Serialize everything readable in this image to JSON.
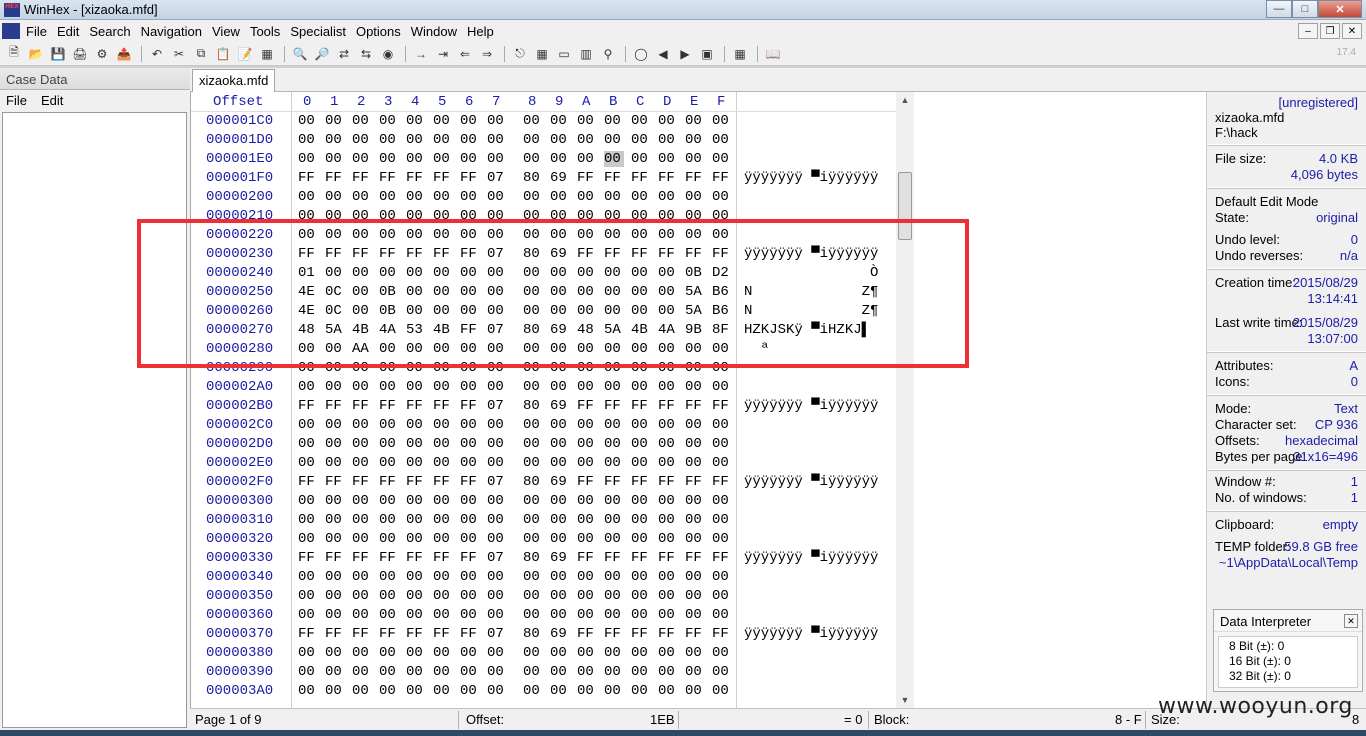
{
  "window": {
    "title": "WinHex - [xizaoka.mfd]",
    "app_icon_text": "HEX"
  },
  "menu": {
    "items": [
      "File",
      "Edit",
      "Search",
      "Navigation",
      "View",
      "Tools",
      "Specialist",
      "Options",
      "Window",
      "Help"
    ]
  },
  "toolbar": {
    "zoom_label": "17.4"
  },
  "case_pane": {
    "title": "Case Data",
    "menu": [
      "File",
      "Edit"
    ]
  },
  "tab": {
    "label": "xizaoka.mfd"
  },
  "hex": {
    "header_offset": "Offset",
    "header_cols": [
      "0",
      "1",
      "2",
      "3",
      "4",
      "5",
      "6",
      "7",
      "8",
      "9",
      "A",
      "B",
      "C",
      "D",
      "E",
      "F"
    ],
    "rows": [
      {
        "off": "000001C0",
        "bytes": [
          "00",
          "00",
          "00",
          "00",
          "00",
          "00",
          "00",
          "00",
          "00",
          "00",
          "00",
          "00",
          "00",
          "00",
          "00",
          "00"
        ],
        "txt": ""
      },
      {
        "off": "000001D0",
        "bytes": [
          "00",
          "00",
          "00",
          "00",
          "00",
          "00",
          "00",
          "00",
          "00",
          "00",
          "00",
          "00",
          "00",
          "00",
          "00",
          "00"
        ],
        "txt": ""
      },
      {
        "off": "000001E0",
        "bytes": [
          "00",
          "00",
          "00",
          "00",
          "00",
          "00",
          "00",
          "00",
          "00",
          "00",
          "00",
          "00",
          "00",
          "00",
          "00",
          "00"
        ],
        "txt": ""
      },
      {
        "off": "000001F0",
        "bytes": [
          "FF",
          "FF",
          "FF",
          "FF",
          "FF",
          "FF",
          "FF",
          "07",
          "80",
          "69",
          "FF",
          "FF",
          "FF",
          "FF",
          "FF",
          "FF"
        ],
        "txt": "ÿÿÿÿÿÿÿ ▀iÿÿÿÿÿÿ"
      },
      {
        "off": "00000200",
        "bytes": [
          "00",
          "00",
          "00",
          "00",
          "00",
          "00",
          "00",
          "00",
          "00",
          "00",
          "00",
          "00",
          "00",
          "00",
          "00",
          "00"
        ],
        "txt": ""
      },
      {
        "off": "00000210",
        "bytes": [
          "00",
          "00",
          "00",
          "00",
          "00",
          "00",
          "00",
          "00",
          "00",
          "00",
          "00",
          "00",
          "00",
          "00",
          "00",
          "00"
        ],
        "txt": ""
      },
      {
        "off": "00000220",
        "bytes": [
          "00",
          "00",
          "00",
          "00",
          "00",
          "00",
          "00",
          "00",
          "00",
          "00",
          "00",
          "00",
          "00",
          "00",
          "00",
          "00"
        ],
        "txt": ""
      },
      {
        "off": "00000230",
        "bytes": [
          "FF",
          "FF",
          "FF",
          "FF",
          "FF",
          "FF",
          "FF",
          "07",
          "80",
          "69",
          "FF",
          "FF",
          "FF",
          "FF",
          "FF",
          "FF"
        ],
        "txt": "ÿÿÿÿÿÿÿ ▀iÿÿÿÿÿÿ"
      },
      {
        "off": "00000240",
        "bytes": [
          "01",
          "00",
          "00",
          "00",
          "00",
          "00",
          "00",
          "00",
          "00",
          "00",
          "00",
          "00",
          "00",
          "00",
          "0B",
          "D2"
        ],
        "txt": "               Ò"
      },
      {
        "off": "00000250",
        "bytes": [
          "4E",
          "0C",
          "00",
          "0B",
          "00",
          "00",
          "00",
          "00",
          "00",
          "00",
          "00",
          "00",
          "00",
          "00",
          "5A",
          "B6"
        ],
        "txt": "N             Z¶"
      },
      {
        "off": "00000260",
        "bytes": [
          "4E",
          "0C",
          "00",
          "0B",
          "00",
          "00",
          "00",
          "00",
          "00",
          "00",
          "00",
          "00",
          "00",
          "00",
          "5A",
          "B6"
        ],
        "txt": "N             Z¶"
      },
      {
        "off": "00000270",
        "bytes": [
          "48",
          "5A",
          "4B",
          "4A",
          "53",
          "4B",
          "FF",
          "07",
          "80",
          "69",
          "48",
          "5A",
          "4B",
          "4A",
          "9B",
          "8F"
        ],
        "txt": "HZKJSKÿ ▀iHZKJ▌"
      },
      {
        "off": "00000280",
        "bytes": [
          "00",
          "00",
          "AA",
          "00",
          "00",
          "00",
          "00",
          "00",
          "00",
          "00",
          "00",
          "00",
          "00",
          "00",
          "00",
          "00"
        ],
        "txt": "  ª"
      },
      {
        "off": "00000290",
        "bytes": [
          "00",
          "00",
          "00",
          "00",
          "00",
          "00",
          "00",
          "00",
          "00",
          "00",
          "00",
          "00",
          "00",
          "00",
          "00",
          "00"
        ],
        "txt": ""
      },
      {
        "off": "000002A0",
        "bytes": [
          "00",
          "00",
          "00",
          "00",
          "00",
          "00",
          "00",
          "00",
          "00",
          "00",
          "00",
          "00",
          "00",
          "00",
          "00",
          "00"
        ],
        "txt": ""
      },
      {
        "off": "000002B0",
        "bytes": [
          "FF",
          "FF",
          "FF",
          "FF",
          "FF",
          "FF",
          "FF",
          "07",
          "80",
          "69",
          "FF",
          "FF",
          "FF",
          "FF",
          "FF",
          "FF"
        ],
        "txt": "ÿÿÿÿÿÿÿ ▀iÿÿÿÿÿÿ"
      },
      {
        "off": "000002C0",
        "bytes": [
          "00",
          "00",
          "00",
          "00",
          "00",
          "00",
          "00",
          "00",
          "00",
          "00",
          "00",
          "00",
          "00",
          "00",
          "00",
          "00"
        ],
        "txt": ""
      },
      {
        "off": "000002D0",
        "bytes": [
          "00",
          "00",
          "00",
          "00",
          "00",
          "00",
          "00",
          "00",
          "00",
          "00",
          "00",
          "00",
          "00",
          "00",
          "00",
          "00"
        ],
        "txt": ""
      },
      {
        "off": "000002E0",
        "bytes": [
          "00",
          "00",
          "00",
          "00",
          "00",
          "00",
          "00",
          "00",
          "00",
          "00",
          "00",
          "00",
          "00",
          "00",
          "00",
          "00"
        ],
        "txt": ""
      },
      {
        "off": "000002F0",
        "bytes": [
          "FF",
          "FF",
          "FF",
          "FF",
          "FF",
          "FF",
          "FF",
          "07",
          "80",
          "69",
          "FF",
          "FF",
          "FF",
          "FF",
          "FF",
          "FF"
        ],
        "txt": "ÿÿÿÿÿÿÿ ▀iÿÿÿÿÿÿ"
      },
      {
        "off": "00000300",
        "bytes": [
          "00",
          "00",
          "00",
          "00",
          "00",
          "00",
          "00",
          "00",
          "00",
          "00",
          "00",
          "00",
          "00",
          "00",
          "00",
          "00"
        ],
        "txt": ""
      },
      {
        "off": "00000310",
        "bytes": [
          "00",
          "00",
          "00",
          "00",
          "00",
          "00",
          "00",
          "00",
          "00",
          "00",
          "00",
          "00",
          "00",
          "00",
          "00",
          "00"
        ],
        "txt": ""
      },
      {
        "off": "00000320",
        "bytes": [
          "00",
          "00",
          "00",
          "00",
          "00",
          "00",
          "00",
          "00",
          "00",
          "00",
          "00",
          "00",
          "00",
          "00",
          "00",
          "00"
        ],
        "txt": ""
      },
      {
        "off": "00000330",
        "bytes": [
          "FF",
          "FF",
          "FF",
          "FF",
          "FF",
          "FF",
          "FF",
          "07",
          "80",
          "69",
          "FF",
          "FF",
          "FF",
          "FF",
          "FF",
          "FF"
        ],
        "txt": "ÿÿÿÿÿÿÿ ▀iÿÿÿÿÿÿ"
      },
      {
        "off": "00000340",
        "bytes": [
          "00",
          "00",
          "00",
          "00",
          "00",
          "00",
          "00",
          "00",
          "00",
          "00",
          "00",
          "00",
          "00",
          "00",
          "00",
          "00"
        ],
        "txt": ""
      },
      {
        "off": "00000350",
        "bytes": [
          "00",
          "00",
          "00",
          "00",
          "00",
          "00",
          "00",
          "00",
          "00",
          "00",
          "00",
          "00",
          "00",
          "00",
          "00",
          "00"
        ],
        "txt": ""
      },
      {
        "off": "00000360",
        "bytes": [
          "00",
          "00",
          "00",
          "00",
          "00",
          "00",
          "00",
          "00",
          "00",
          "00",
          "00",
          "00",
          "00",
          "00",
          "00",
          "00"
        ],
        "txt": ""
      },
      {
        "off": "00000370",
        "bytes": [
          "FF",
          "FF",
          "FF",
          "FF",
          "FF",
          "FF",
          "FF",
          "07",
          "80",
          "69",
          "FF",
          "FF",
          "FF",
          "FF",
          "FF",
          "FF"
        ],
        "txt": "ÿÿÿÿÿÿÿ ▀iÿÿÿÿÿÿ"
      },
      {
        "off": "00000380",
        "bytes": [
          "00",
          "00",
          "00",
          "00",
          "00",
          "00",
          "00",
          "00",
          "00",
          "00",
          "00",
          "00",
          "00",
          "00",
          "00",
          "00"
        ],
        "txt": ""
      },
      {
        "off": "00000390",
        "bytes": [
          "00",
          "00",
          "00",
          "00",
          "00",
          "00",
          "00",
          "00",
          "00",
          "00",
          "00",
          "00",
          "00",
          "00",
          "00",
          "00"
        ],
        "txt": ""
      },
      {
        "off": "000003A0",
        "bytes": [
          "00",
          "00",
          "00",
          "00",
          "00",
          "00",
          "00",
          "00",
          "00",
          "00",
          "00",
          "00",
          "00",
          "00",
          "00",
          "00"
        ],
        "txt": ""
      }
    ]
  },
  "info": {
    "unregistered": "[unregistered]",
    "filename": "xizaoka.mfd",
    "path": "F:\\hack",
    "file_size_label": "File size:",
    "file_size_kb": "4.0 KB",
    "file_size_bytes": "4,096 bytes",
    "edit_mode_label": "Default Edit Mode",
    "state_label": "State:",
    "state_value": "original",
    "undo_level_label": "Undo level:",
    "undo_level_value": "0",
    "undo_rev_label": "Undo reverses:",
    "undo_rev_value": "n/a",
    "creation_label": "Creation time:",
    "creation_date": "2015/08/29",
    "creation_time": "13:14:41",
    "write_label": "Last write time:",
    "write_date": "2015/08/29",
    "write_time": "13:07:00",
    "attributes_label": "Attributes:",
    "attributes_value": "A",
    "icons_label": "Icons:",
    "icons_value": "0",
    "mode_label": "Mode:",
    "mode_value": "Text",
    "charset_label": "Character set:",
    "charset_value": "CP 936",
    "offsets_label": "Offsets:",
    "offsets_value": "hexadecimal",
    "bpp_label": "Bytes per page:",
    "bpp_value": "31x16=496",
    "winnum_label": "Window #:",
    "winnum_value": "1",
    "nwin_label": "No. of windows:",
    "nwin_value": "1",
    "clipboard_label": "Clipboard:",
    "clipboard_value": "empty",
    "temp_label": "TEMP folder:",
    "temp_free": "59.8 GB free",
    "temp_path": "~1\\AppData\\Local\\Temp"
  },
  "data_interpreter": {
    "title": "Data Interpreter",
    "rows": [
      "8 Bit (±): 0",
      "16 Bit (±): 0",
      "32 Bit (±): 0"
    ]
  },
  "status": {
    "page": "Page 1 of 9",
    "offset_label": "Offset:",
    "offset_value": "1EB",
    "eq": "= 0",
    "block_label": "Block:",
    "block_value": "8 - F",
    "size_label": "Size:",
    "size_value": "8"
  },
  "watermark": "www.wooyun.org",
  "colors": {
    "highlight_box": "#ee2f36",
    "offset_blue": "#1c1ca8"
  }
}
